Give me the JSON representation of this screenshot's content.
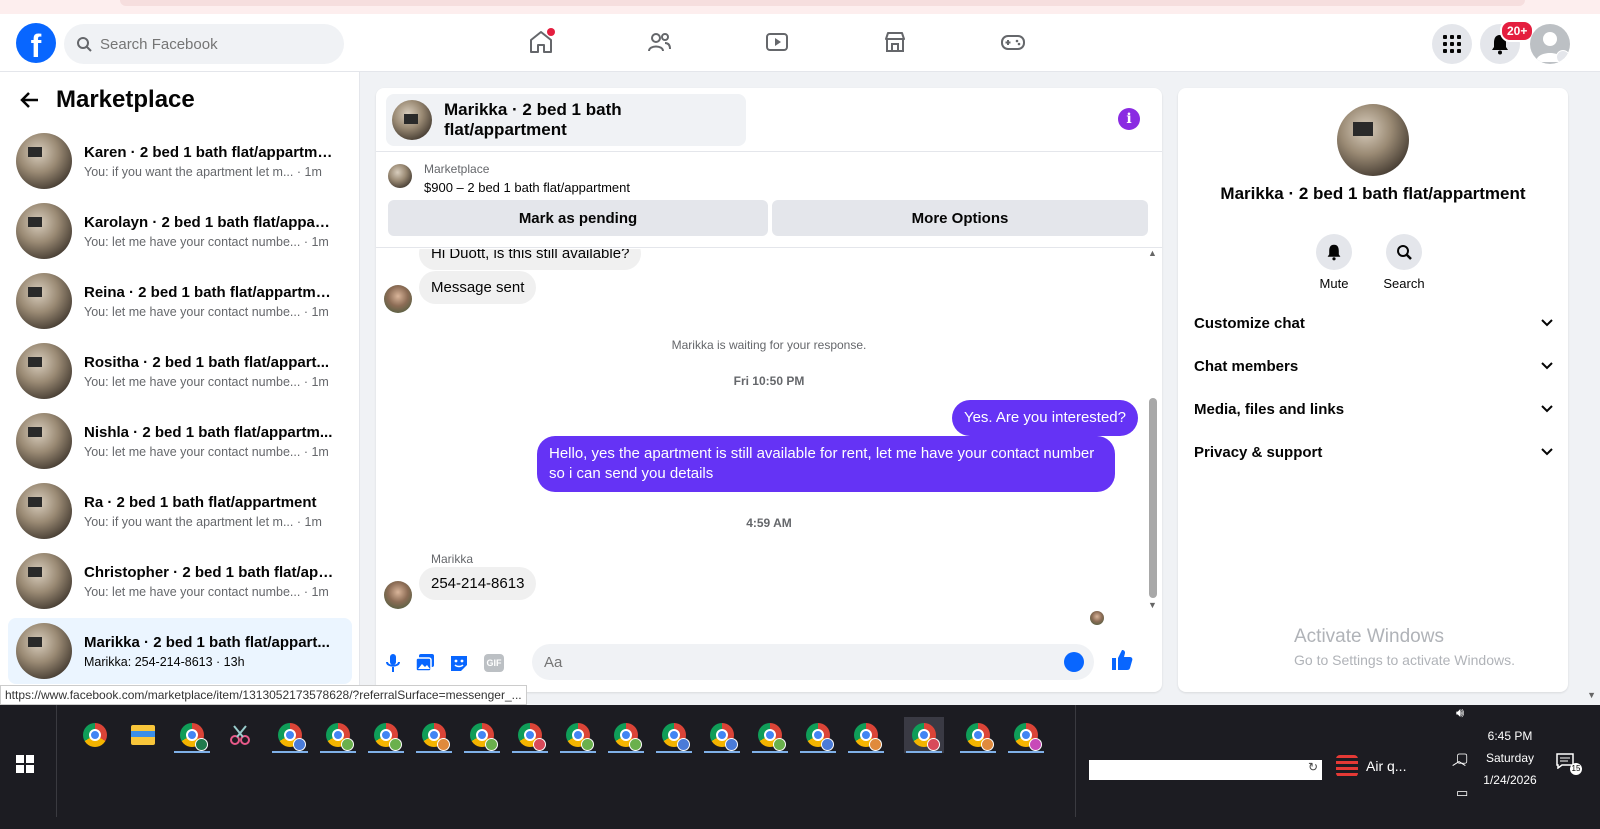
{
  "header": {
    "search_placeholder": "Search Facebook",
    "notifications_badge": "20+",
    "nav_icons": [
      "home-icon",
      "friends-icon",
      "watch-icon",
      "marketplace-icon",
      "gaming-icon"
    ]
  },
  "sidebar": {
    "title": "Marketplace",
    "conversations": [
      {
        "name": "Karen · 2 bed 1 bath flat/appartment",
        "preview": "You: if you want the apartment let m...",
        "time": "· 1m",
        "active": false
      },
      {
        "name": "Karolayn · 2 bed 1 bath flat/appart...",
        "preview": "You: let me have your contact numbe...",
        "time": "· 1m",
        "active": false
      },
      {
        "name": "Reina · 2 bed 1 bath flat/appartment",
        "preview": "You: let me have your contact numbe...",
        "time": "· 1m",
        "active": false
      },
      {
        "name": "Rositha · 2 bed 1 bath flat/appart...",
        "preview": "You: let me have your contact numbe...",
        "time": "· 1m",
        "active": false
      },
      {
        "name": "Nishla · 2 bed 1 bath flat/appartm...",
        "preview": "You: let me have your contact numbe...",
        "time": "· 1m",
        "active": false
      },
      {
        "name": "Ra · 2 bed 1 bath flat/appartment",
        "preview": "You: if you want the apartment let m...",
        "time": "· 1m",
        "active": false
      },
      {
        "name": "Christopher · 2 bed 1 bath flat/app...",
        "preview": "You: let me have your contact numbe...",
        "time": "· 1m",
        "active": false
      },
      {
        "name": "Marikka · 2 bed 1 bath flat/appart...",
        "preview": "Marikka: 254-214-8613",
        "time": "· 13h",
        "active": true
      }
    ]
  },
  "chat": {
    "title": "Marikka · 2 bed 1 bath flat/appartment",
    "listing_category": "Marketplace",
    "listing_price": "$900 – 2 bed 1 bath flat/appartment",
    "mark_pending_label": "Mark as pending",
    "more_options_label": "More Options",
    "messages": {
      "partial_top": "Hi Duott, is this still available?",
      "message_sent": "Message sent",
      "waiting_notice": "Marikka is waiting for your response.",
      "time_1": "Fri 10:50 PM",
      "out_1": "Yes. Are you interested?",
      "out_2": "Hello, yes the apartment is still available for rent, let me have your contact number so i can send you details",
      "time_2": "4:59 AM",
      "sender": "Marikka",
      "in_phone": "254-214-8613"
    },
    "composer_placeholder": "Aa"
  },
  "info_panel": {
    "name": "Marikka · 2 bed 1 bath flat/appartment",
    "mute_label": "Mute",
    "search_label": "Search",
    "accordions": [
      "Customize chat",
      "Chat members",
      "Media, files and links",
      "Privacy & support"
    ],
    "watermark_title": "Activate Windows",
    "watermark_sub": "Go to Settings to activate Windows."
  },
  "status_url": "https://www.facebook.com/marketplace/item/1313052173578628/?referralSurface=messenger_...",
  "taskbar": {
    "air_label": "Air q...",
    "time": "6:45 PM",
    "day": "Saturday",
    "date": "1/24/2026",
    "notification_count": "15",
    "profile_colors": [
      "#4a7bd8",
      "#6ab04c",
      "#6ab04c",
      "#e08a3c",
      "#6ab04c",
      "#d84a5a",
      "#6ab04c",
      "#6ab04c",
      "#4a7bd8",
      "#4a7bd8",
      "#6ab04c",
      "#4a7bd8",
      "#e08a3c",
      "#d84a5a",
      "#e08a3c",
      "#c84ab8"
    ]
  },
  "colors": {
    "brand": "#0866ff",
    "outgoing_bubble": "#6533f5",
    "badge": "#e41e3f"
  }
}
